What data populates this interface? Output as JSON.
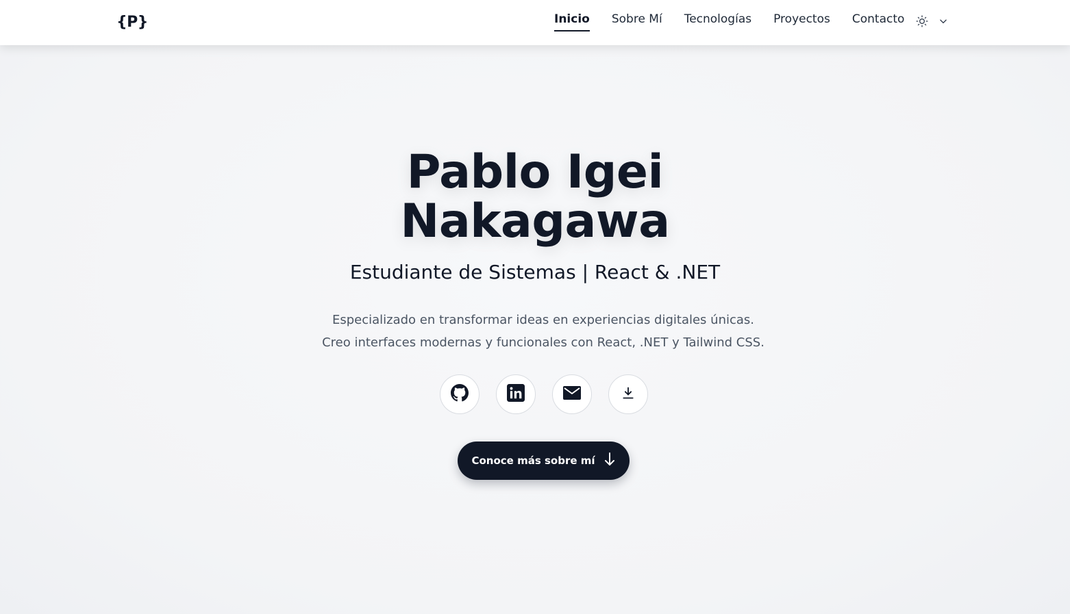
{
  "brand": {
    "logo_text": "{P}"
  },
  "nav": {
    "items": [
      {
        "label": "Inicio",
        "active": true
      },
      {
        "label": "Sobre Mí",
        "active": false
      },
      {
        "label": "Tecnologías",
        "active": false
      },
      {
        "label": "Proyectos",
        "active": false
      },
      {
        "label": "Contacto",
        "active": false
      }
    ],
    "theme_icon": "sun-icon",
    "dropdown_icon": "chevron-down-icon"
  },
  "hero": {
    "title_line1": "Pablo Igei",
    "title_line2": "Nakagawa",
    "subtitle": "Estudiante de Sistemas | React & .NET",
    "description": "Especializado en transformar ideas en experiencias digitales únicas. Creo interfaces modernas y funcionales con React, .NET y Tailwind CSS.",
    "socials": [
      {
        "icon": "github-icon"
      },
      {
        "icon": "linkedin-icon"
      },
      {
        "icon": "mail-icon"
      },
      {
        "icon": "download-icon"
      }
    ],
    "cta_label": "Conoce más sobre mí",
    "cta_icon": "arrow-down-icon"
  },
  "colors": {
    "primary": "#111827",
    "background": "#f5f6f8",
    "text_muted": "#4b5563"
  }
}
